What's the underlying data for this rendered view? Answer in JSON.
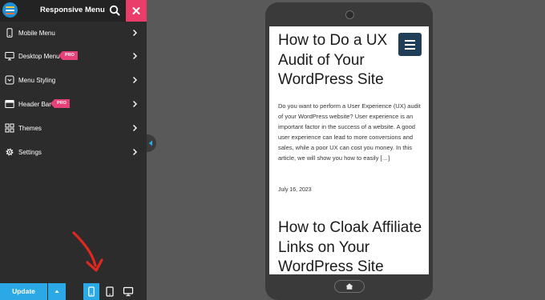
{
  "sidebar": {
    "title": "Responsive Menu",
    "items": [
      {
        "label": "Mobile Menu",
        "icon": "mobile-icon",
        "pro": ""
      },
      {
        "label": "Desktop Menu",
        "icon": "desktop-icon",
        "pro": "PRO"
      },
      {
        "label": "Menu Styling",
        "icon": "menu-styling-icon",
        "pro": ""
      },
      {
        "label": "Header Bar",
        "icon": "header-bar-icon",
        "pro": "PRO"
      },
      {
        "label": "Themes",
        "icon": "themes-icon",
        "pro": ""
      },
      {
        "label": "Settings",
        "icon": "settings-icon",
        "pro": ""
      }
    ],
    "footer": {
      "update_label": "Update",
      "active_device": "mobile"
    }
  },
  "preview": {
    "posts": [
      {
        "title": "How to Do a UX Audit of Your WordPress Site",
        "excerpt": "Do you want to perform a User Experience (UX) audit of your WordPress website? User experience is an important factor in the success of a website. A good user experience can lead to more conversions and sales, while a poor UX can cost you money. In this article, we will show you how to easily […]",
        "date": "July 16, 2023"
      },
      {
        "title": "How to Cloak Affiliate Links on Your WordPress Site"
      }
    ]
  },
  "colors": {
    "accent_blue": "#2aa9e6",
    "close_pink": "#ea3d6a",
    "pro_badge": "#e8417a",
    "sidebar_bg": "#2c2c2c",
    "canvas_bg": "#595959",
    "hamburger_bg": "#1e3f57",
    "annotation_arrow": "#e0281e"
  }
}
